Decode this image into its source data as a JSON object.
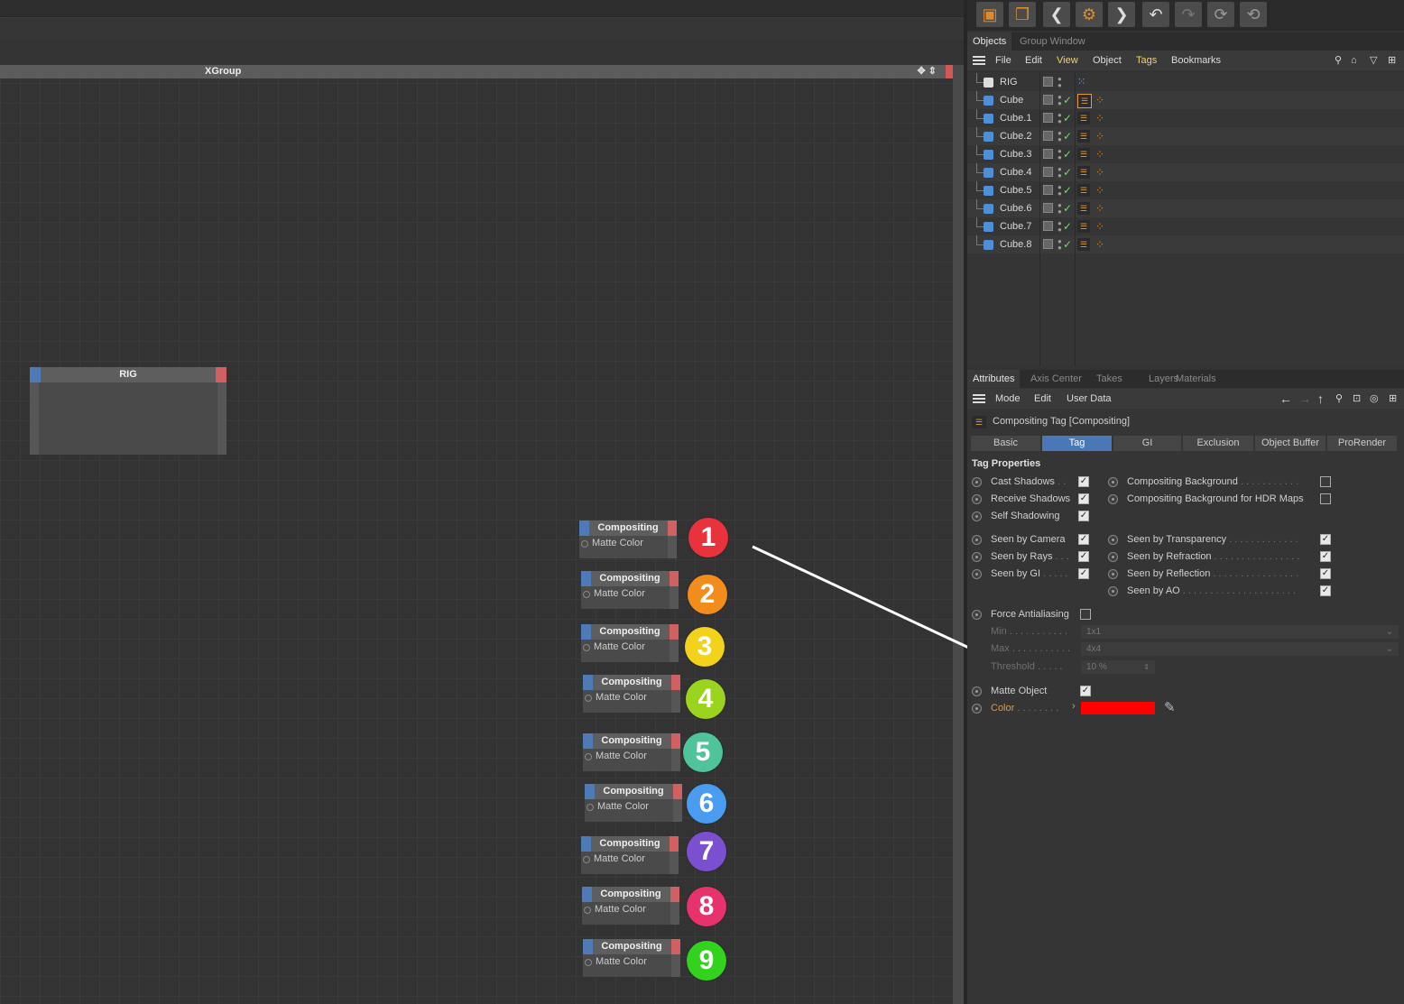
{
  "editor": {
    "xgroup_title": "XGroup",
    "rig_node_title": "RIG",
    "node_title": "Compositing",
    "node_port_label": "Matte Color",
    "numbers": [
      "1",
      "2",
      "3",
      "4",
      "5",
      "6",
      "7",
      "8",
      "9"
    ],
    "number_colors": [
      "#e8323c",
      "#f28c1a",
      "#f2d21a",
      "#9bd41e",
      "#4fc49a",
      "#4a9cf0",
      "#7a4fd0",
      "#e8326c",
      "#32d21e"
    ]
  },
  "objects_panel": {
    "tabs": [
      "Objects",
      "Group Window"
    ],
    "menu": [
      "File",
      "Edit",
      "View",
      "Object",
      "Tags",
      "Bookmarks"
    ],
    "items": [
      "RIG",
      "Cube",
      "Cube.1",
      "Cube.2",
      "Cube.3",
      "Cube.4",
      "Cube.5",
      "Cube.6",
      "Cube.7",
      "Cube.8"
    ]
  },
  "attributes_panel": {
    "tabs": [
      "Attributes",
      "Axis Center",
      "Takes",
      "Layers",
      "Materials"
    ],
    "menu": [
      "Mode",
      "Edit",
      "User Data"
    ],
    "title": "Compositing Tag [Compositing]",
    "subtabs": [
      "Basic",
      "Tag",
      "GI",
      "Exclusion",
      "Object Buffer",
      "ProRender"
    ],
    "section": "Tag Properties",
    "left_props": [
      {
        "label": "Cast Shadows",
        "dots": " . .",
        "checked": true
      },
      {
        "label": "Receive Shadows",
        "dots": "",
        "checked": true
      },
      {
        "label": "Self Shadowing",
        "dots": "",
        "checked": true
      },
      {
        "label": "Seen by Camera",
        "dots": "",
        "checked": true
      },
      {
        "label": "Seen by Rays",
        "dots": " . . .",
        "checked": true
      },
      {
        "label": "Seen by GI",
        "dots": " . . . . .",
        "checked": true
      }
    ],
    "right_props": [
      {
        "label": "Compositing Background",
        "dots": " . . . . . . . . . . .",
        "checked": false
      },
      {
        "label": "Compositing Background for HDR Maps",
        "dots": "",
        "checked": false
      },
      {
        "label": "Seen by Transparency",
        "dots": " . . . . . . . . . . . . .",
        "checked": true
      },
      {
        "label": "Seen by Refraction",
        "dots": " . . . . . . . . . . . . . . . .",
        "checked": true
      },
      {
        "label": "Seen by Reflection",
        "dots": " . . . . . . . . . . . . . . . .",
        "checked": true
      },
      {
        "label": "Seen by AO",
        "dots": " . . . . . . . . . . . . . . . . . . . . .",
        "checked": true
      }
    ],
    "force_aa": "Force Antialiasing",
    "min_label": "Min",
    "min_dots": " . . . . . . . . . . .",
    "min_value": "1x1",
    "max_label": "Max",
    "max_dots": " . . . . . . . . . . .",
    "max_value": "4x4",
    "threshold_label": "Threshold",
    "threshold_dots": " . . . . .",
    "threshold_value": "10 %",
    "matte_object": "Matte Object",
    "color_label": "Color",
    "color_dots": " . . . . . . . .",
    "color_value": "#ff0000"
  }
}
